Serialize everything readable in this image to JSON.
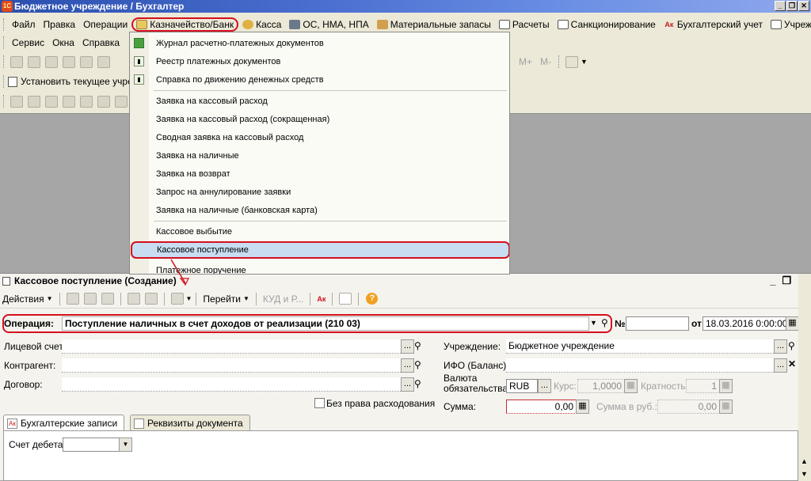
{
  "window": {
    "title": "Бюджетное учреждение / Бухгалтер",
    "controls": {
      "minimize": "_",
      "restore": "❐",
      "close": "✕"
    }
  },
  "menu": {
    "row1": [
      {
        "label": "Файл",
        "icon": ""
      },
      {
        "label": "Правка",
        "icon": ""
      },
      {
        "label": "Операции",
        "icon": ""
      },
      {
        "label": "Казначейство/Банк",
        "icon": "bank-icon"
      },
      {
        "label": "Касса",
        "icon": "coins-icon"
      },
      {
        "label": "ОС, НМА, НПА",
        "icon": "truck-icon"
      },
      {
        "label": "Материальные запасы",
        "icon": "boxes-icon"
      },
      {
        "label": "Расчеты",
        "icon": "document-icon"
      },
      {
        "label": "Санкционирование",
        "icon": "ledger-icon"
      },
      {
        "label": "Бухгалтерский учет",
        "icon": "accounting-icon"
      },
      {
        "label": "Учреждение",
        "icon": "building-icon"
      }
    ],
    "row2": [
      {
        "label": "Сервис"
      },
      {
        "label": "Окна"
      },
      {
        "label": "Справка"
      }
    ],
    "set_institution": "Установить текущее учреж"
  },
  "toolbar_right": {
    "m_plus": "M+",
    "m_minus": "M-"
  },
  "dropdown": {
    "items": [
      {
        "label": "Журнал  расчетно-платежных документов",
        "icon": "journal-icon"
      },
      {
        "label": "Реестр платежных документов",
        "icon": "report-icon"
      },
      {
        "label": "Справка по движению денежных средств",
        "icon": "report-icon"
      },
      {
        "label": "Заявка на кассовый расход",
        "icon": ""
      },
      {
        "label": "Заявка на кассовый расход (сокращенная)",
        "icon": ""
      },
      {
        "label": "Сводная заявка на кассовый расход",
        "icon": ""
      },
      {
        "label": "Заявка на наличные",
        "icon": ""
      },
      {
        "label": "Заявка на возврат",
        "icon": ""
      },
      {
        "label": "Запрос на аннулирование заявки",
        "icon": ""
      },
      {
        "label": "Заявка на наличные (банковская карта)",
        "icon": ""
      },
      {
        "label": "Кассовое выбытие",
        "icon": ""
      },
      {
        "label": "Кассовое поступление",
        "icon": ""
      },
      {
        "label": "Платежное поручение",
        "icon": ""
      }
    ]
  },
  "doc": {
    "title": "Кассовое поступление (Создание)",
    "toolbar": {
      "actions": "Действия",
      "goto": "Перейти",
      "kud": "КУД и Р..."
    },
    "operation_label": "Операция:",
    "operation_value": "Поступление наличных в счет доходов от реализации (210 03)",
    "number_label": "№:",
    "number_value": "",
    "date_label": "от",
    "date_value": "18.03.2016  0:00:00",
    "personal_account_label": "Лицевой счет:",
    "personal_account_value": "",
    "counterparty_label": "Контрагент:",
    "counterparty_value": "",
    "contract_label": "Договор:",
    "contract_value": "",
    "no_spending_right": "Без права расходования",
    "institution_label": "Учреждение:",
    "institution_value": "Бюджетное учреждение",
    "ifo_label": "ИФО (Баланс):",
    "ifo_value": "",
    "currency_label_line1": "Валюта",
    "currency_label_line2": "обязательства:",
    "currency_value": "RUB",
    "rate_label": "Курс:",
    "rate_value": "1,0000",
    "multiplicity_label": "Кратность:",
    "multiplicity_value": "1",
    "sum_label": "Сумма:",
    "sum_value": "0,00",
    "sum_rub_label": "Сумма в руб.:",
    "sum_rub_value": "0,00",
    "tabs": [
      {
        "label": "Бухгалтерские записи"
      },
      {
        "label": "Реквизиты документа"
      }
    ],
    "debit_account_label": "Счет дебета:",
    "debit_account_value": ""
  }
}
